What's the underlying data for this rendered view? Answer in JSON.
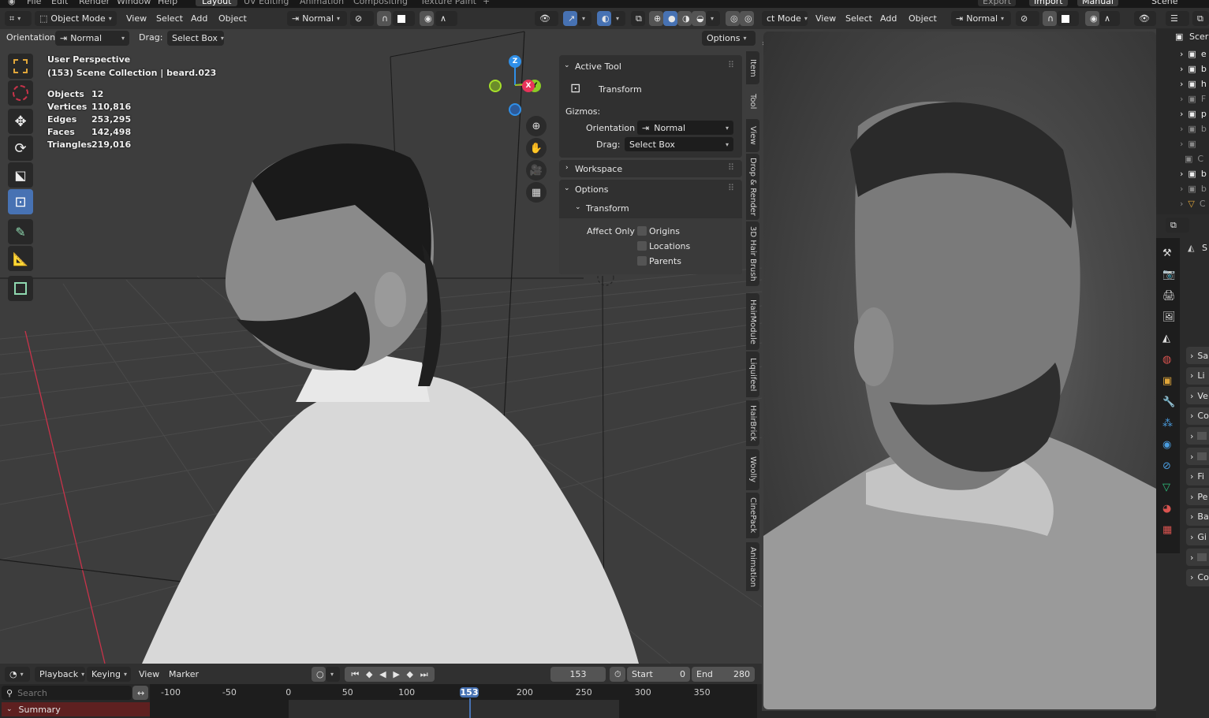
{
  "topbar": {
    "menus": [
      "File",
      "Edit",
      "Render",
      "Window",
      "Help"
    ],
    "workspaces": [
      {
        "label": "Layout",
        "active": true
      },
      {
        "label": "UV Editing",
        "active": false
      },
      {
        "label": "Animation",
        "active": false
      },
      {
        "label": "Compositing",
        "active": false
      },
      {
        "label": "Texture Paint",
        "active": false
      }
    ],
    "add_workspace": "+",
    "right_buttons": [
      "Export",
      "Import",
      "Manual"
    ],
    "scene_label": "Scene"
  },
  "left_viewport": {
    "header": {
      "mode": "Object Mode",
      "menus": [
        "View",
        "Select",
        "Add",
        "Object"
      ],
      "transform_orientation": "Normal",
      "options_label": "Options"
    },
    "tool_settings": {
      "orientation_label": "Orientation:",
      "orientation_value": "Normal",
      "drag_label": "Drag:",
      "drag_value": "Select Box"
    },
    "overlay": {
      "view_name": "User Perspective",
      "collection_line": "(153) Scene Collection | beard.023",
      "stats": [
        {
          "label": "Objects",
          "value": "12"
        },
        {
          "label": "Vertices",
          "value": "110,816"
        },
        {
          "label": "Edges",
          "value": "253,295"
        },
        {
          "label": "Faces",
          "value": "142,498"
        },
        {
          "label": "Triangles",
          "value": "219,016"
        }
      ]
    },
    "tools": [
      "select-box",
      "cursor",
      "move",
      "rotate",
      "scale",
      "transform",
      "annotate",
      "measure",
      "add-cube"
    ],
    "active_tool": "transform",
    "gizmo": {
      "z": "Z",
      "x": "X",
      "y": "Y"
    },
    "nav_buttons": [
      "zoom",
      "pan",
      "camera",
      "perspective-toggle"
    ],
    "n_panel": {
      "active_tool_header": "Active Tool",
      "tool_name": "Transform",
      "gizmos_label": "Gizmos:",
      "orientation_label": "Orientation",
      "orientation_value": "Normal",
      "drag_label": "Drag:",
      "drag_value": "Select Box",
      "workspace_header": "Workspace",
      "options_header": "Options",
      "transform_header": "Transform",
      "affect_only_label": "Affect Only",
      "checkboxes": [
        {
          "label": "Origins",
          "checked": false
        },
        {
          "label": "Locations",
          "checked": false
        },
        {
          "label": "Parents",
          "checked": false
        }
      ]
    },
    "side_tabs": [
      "Item",
      "Tool",
      "View",
      "Drop & Render",
      "3D Hair Brush",
      "HairModule",
      "Liquifeel",
      "HairBrick",
      "Woolly",
      "CinePack",
      "Animation"
    ],
    "active_side_tab": "Tool"
  },
  "right_viewport": {
    "header": {
      "mode": "ct Mode",
      "menus": [
        "View",
        "Select",
        "Add",
        "Object"
      ],
      "transform_orientation": "Normal"
    }
  },
  "outliner": {
    "root": "Scer",
    "rows": [
      "e",
      "b",
      "h",
      "F",
      "p",
      "b",
      "",
      "C",
      "b",
      "b",
      "C"
    ]
  },
  "properties": {
    "header_initial": "S",
    "sections": [
      "Sa",
      "Li",
      "Ve",
      "Co",
      "",
      "",
      "Fi",
      "Pe",
      "Ba",
      "Gi",
      "",
      "Co"
    ]
  },
  "timeline": {
    "menus": [
      "Playback",
      "Keying",
      "View",
      "Marker"
    ],
    "current_frame": "153",
    "start_label": "Start",
    "start_value": "0",
    "end_label": "End",
    "end_value": "280",
    "search_placeholder": "Search",
    "summary_label": "Summary",
    "ruler": [
      "-100",
      "-50",
      "0",
      "50",
      "100",
      "153",
      "200",
      "250",
      "300",
      "350"
    ],
    "colors": {
      "playhead": "#4772b3",
      "summary": "#5e2020"
    }
  }
}
